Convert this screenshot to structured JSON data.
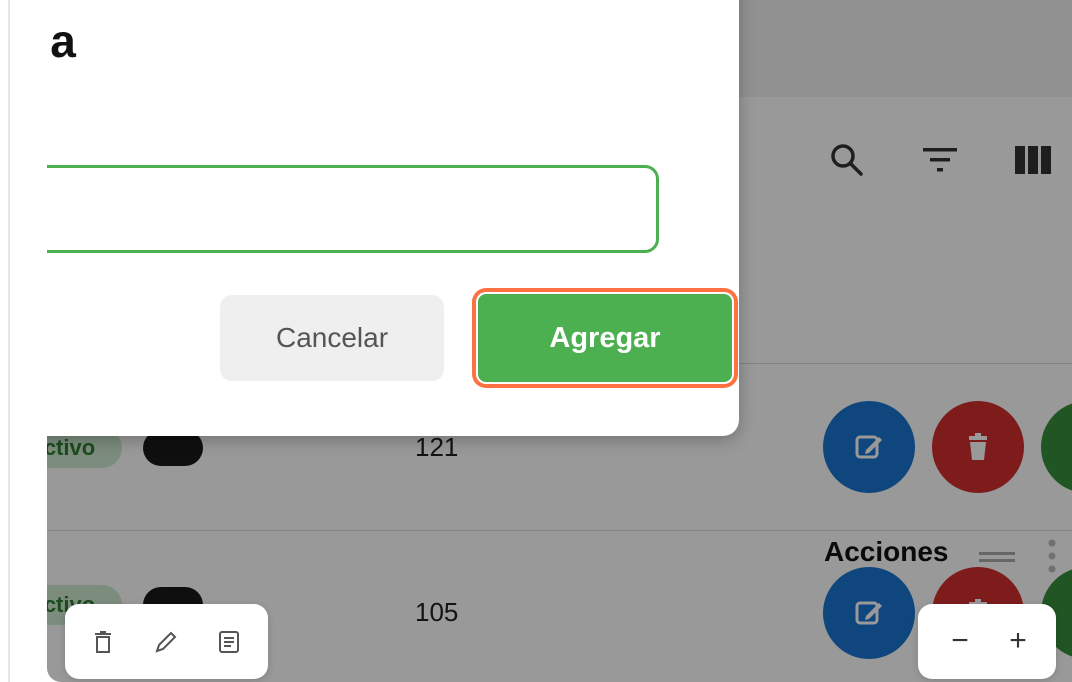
{
  "modal": {
    "title": "la",
    "input_value": "",
    "input_placeholder": "",
    "cancel_label": "Cancelar",
    "add_label": "Agregar"
  },
  "table": {
    "actions_header": "Acciones",
    "rows": [
      {
        "status": "ctivo",
        "id": "121"
      },
      {
        "status": "ctivo",
        "id": "105"
      }
    ]
  },
  "toolbar": {
    "icons": [
      "search-icon",
      "filter-icon",
      "columns-icon"
    ]
  },
  "floating_tools": {
    "icons": [
      "trash-icon",
      "pencil-icon",
      "notes-icon"
    ]
  },
  "zoom": {
    "minus": "−",
    "plus": "+"
  },
  "colors": {
    "primary_green": "#4caf50",
    "highlight_orange": "#ff7043",
    "edit_blue": "#1976d2",
    "delete_red": "#d32f2f",
    "extra_green": "#388e3c"
  }
}
